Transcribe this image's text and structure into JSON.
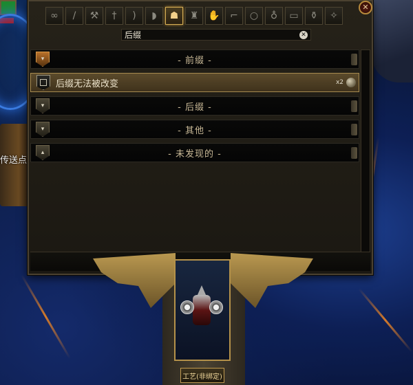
{
  "background": {
    "location_label": "传送点"
  },
  "tabs": [
    {
      "icon": "infinity-icon",
      "glyph": "∞"
    },
    {
      "icon": "dagger-icon",
      "glyph": "/"
    },
    {
      "icon": "axe-icon",
      "glyph": "⚒"
    },
    {
      "icon": "sceptre-icon",
      "glyph": "†"
    },
    {
      "icon": "bow-icon",
      "glyph": ")"
    },
    {
      "icon": "shield-icon",
      "glyph": "◗"
    },
    {
      "icon": "helmet-icon",
      "glyph": "☗"
    },
    {
      "icon": "chest-armor-icon",
      "glyph": "♜"
    },
    {
      "icon": "gloves-icon",
      "glyph": "✋"
    },
    {
      "icon": "boots-icon",
      "glyph": "⌐"
    },
    {
      "icon": "ring-icon",
      "glyph": "○"
    },
    {
      "icon": "amulet-icon",
      "glyph": "♁"
    },
    {
      "icon": "belt-icon",
      "glyph": "▭"
    },
    {
      "icon": "flask-icon",
      "glyph": "⚱"
    },
    {
      "icon": "jewel-icon",
      "glyph": "✧"
    }
  ],
  "active_tab_index": 6,
  "search": {
    "value": "后缀",
    "clear_glyph": "✕"
  },
  "close_glyph": "✕",
  "list": {
    "prefix_header": "- 前缀 -",
    "entry": {
      "label": "后缀无法被改变",
      "count": "x2"
    },
    "suffix_header": "- 后缀 -",
    "other_header": "- 其他 -",
    "undiscovered_header": "- 未发现的 -"
  },
  "craft_button": "工艺(非绑定)"
}
